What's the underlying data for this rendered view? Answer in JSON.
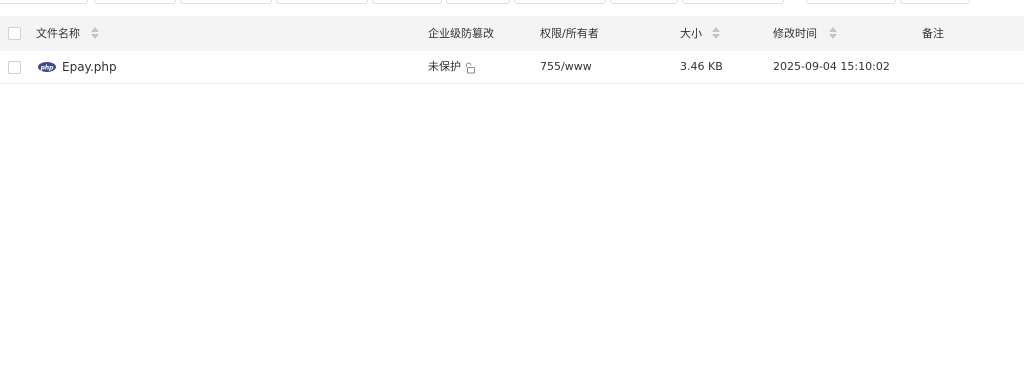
{
  "table": {
    "columns": {
      "name": "文件名称",
      "tamper": "企业级防篡改",
      "perm": "权限/所有者",
      "size": "大小",
      "mtime": "修改时间",
      "note": "备注"
    },
    "rows": [
      {
        "name": "Epay.php",
        "tamper": "未保护",
        "perm": "755/www",
        "size": "3.46 KB",
        "mtime": "2025-09-04 15:10:02",
        "note": ""
      }
    ]
  },
  "icons": {
    "file_type": "php-file-icon",
    "lock": "unlocked-icon",
    "sort": "sort-icon"
  },
  "colors": {
    "header_bg": "#f4f4f4",
    "php_icon": "#3d4a8a",
    "sort_arrow": "#c0c4cc"
  }
}
